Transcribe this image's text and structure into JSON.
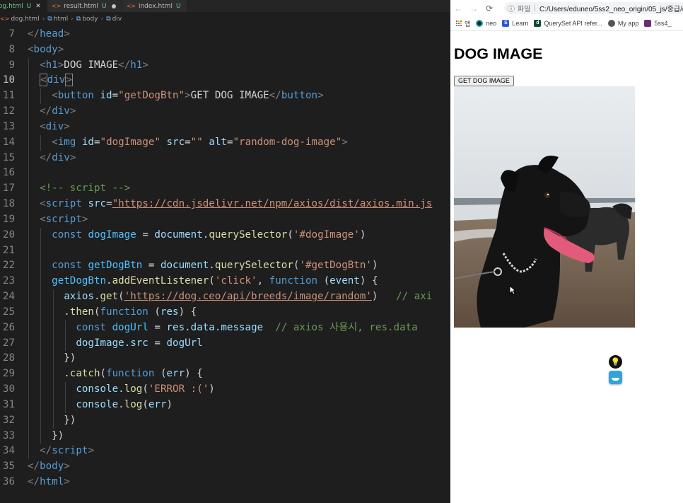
{
  "editor": {
    "tabs": [
      {
        "label": "og.html",
        "status": "U",
        "active": true
      },
      {
        "label": "result.html",
        "status": "U",
        "active": false
      },
      {
        "label": "index.html",
        "status": "U",
        "active": false
      }
    ],
    "breadcrumb": [
      "dog.html",
      "html",
      "body",
      "div"
    ],
    "lines": [
      {
        "n": "7"
      },
      {
        "n": "8"
      },
      {
        "n": "9"
      },
      {
        "n": "10"
      },
      {
        "n": "11"
      },
      {
        "n": "12"
      },
      {
        "n": "13"
      },
      {
        "n": "14"
      },
      {
        "n": "15"
      },
      {
        "n": "16"
      },
      {
        "n": "17"
      },
      {
        "n": "18"
      },
      {
        "n": "19"
      },
      {
        "n": "20"
      },
      {
        "n": "21"
      },
      {
        "n": "22"
      },
      {
        "n": "23"
      },
      {
        "n": "24"
      },
      {
        "n": "25"
      },
      {
        "n": "26"
      },
      {
        "n": "27"
      },
      {
        "n": "28"
      },
      {
        "n": "29"
      },
      {
        "n": "30"
      },
      {
        "n": "31"
      },
      {
        "n": "32"
      },
      {
        "n": "33"
      },
      {
        "n": "34"
      },
      {
        "n": "35"
      },
      {
        "n": "36"
      }
    ],
    "code": {
      "l7_head": "head",
      "l8_body": "body",
      "l9_h1": "h1",
      "l9_text": "DOG IMAGE",
      "l10_div": "div",
      "l11_button": "button",
      "l11_id": "id",
      "l11_id_val": "\"getDogBtn\"",
      "l11_text": "GET DOG IMAGE",
      "l12_div": "div",
      "l13_div": "div",
      "l14_img": "img",
      "l14_id": "id",
      "l14_id_val": "\"dogImage\"",
      "l14_src": "src",
      "l14_src_val": "\"\"",
      "l14_alt": "alt",
      "l14_alt_val": "\"random-dog-image\"",
      "l15_div": "div",
      "l17_comment": "<!-- script -->",
      "l18_script": "script",
      "l18_src": "src",
      "l18_url": "\"https://cdn.jsdelivr.net/npm/axios/dist/axios.min.js",
      "l19_script": "script",
      "l20_const": "const",
      "l20_var": "dogImage",
      "l20_doc": "document",
      "l20_fn": "querySelector",
      "l20_arg": "'#dogImage'",
      "l22_const": "const",
      "l22_var": "getDogBtn",
      "l22_doc": "document",
      "l22_fn": "querySelector",
      "l22_arg": "'#getDogBtn'",
      "l23_obj": "getDogBtn",
      "l23_fn": "addEventListener",
      "l23_arg": "'click'",
      "l23_kw": "function",
      "l23_param": "event",
      "l24_obj": "axios",
      "l24_fn": "get",
      "l24_url": "'https://dog.ceo/api/breeds/image/random'",
      "l24_comment": "// axi",
      "l25_fn": "then",
      "l25_kw": "function",
      "l25_param": "res",
      "l26_const": "const",
      "l26_var": "dogUrl",
      "l26_expr": "res.data.message",
      "l26_comment": "// axios 사용시, res.data",
      "l27_lhs": "dogImage.src",
      "l27_rhs": "dogUrl",
      "l28_close": "})",
      "l29_fn": "catch",
      "l29_kw": "function",
      "l29_param": "err",
      "l30_obj": "console",
      "l30_fn": "log",
      "l30_arg": "'ERROR :('",
      "l31_obj": "console",
      "l31_fn": "log",
      "l31_arg": "err",
      "l32_close": "})",
      "l33_close": "})",
      "l34_script": "script",
      "l35_body": "body",
      "l36_html": "html"
    }
  },
  "browser": {
    "address_prefix": "파일",
    "address": "C:/Users/eduneo/5ss2_neo_origin/05_js/중급/d",
    "bookmarks": [
      "앱",
      "neo",
      "Learn",
      "QuerySet API refer...",
      "My app",
      "5ss4_"
    ],
    "page_title": "DOG IMAGE",
    "button_label": "GET DOG IMAGE",
    "image_alt": "random-dog-image"
  },
  "colors": {
    "editor_bg": "#1e1e1e",
    "tag": "#569cd6",
    "attribute": "#9cdcfe",
    "string": "#ce9178",
    "function": "#dcdcaa",
    "comment": "#6a9955",
    "browser_bg": "#ffffff"
  }
}
